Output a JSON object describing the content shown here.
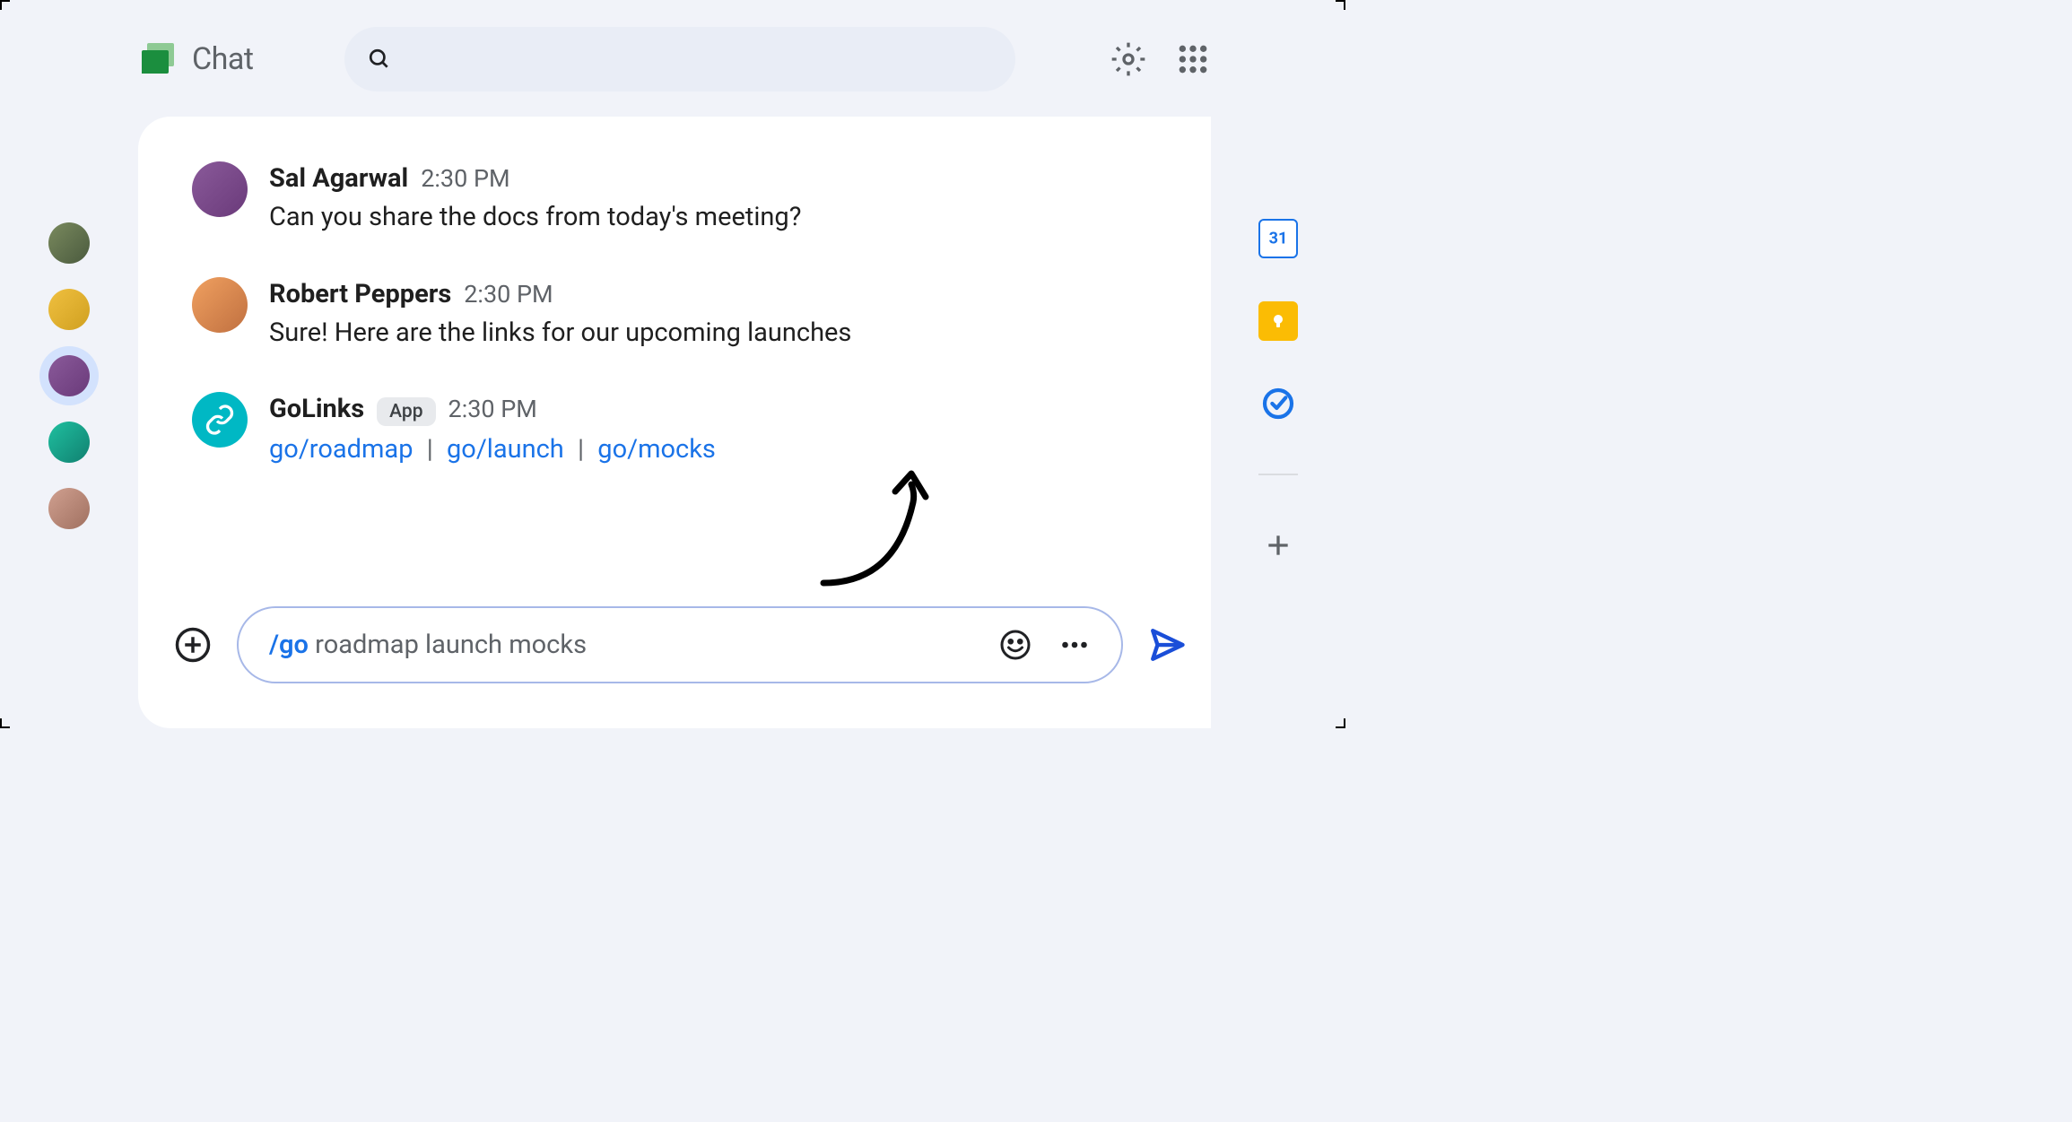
{
  "header": {
    "app_name": "Chat"
  },
  "left_rail": {
    "avatars": [
      {
        "id": "av1"
      },
      {
        "id": "av2"
      },
      {
        "id": "av3",
        "active": true
      },
      {
        "id": "av4"
      },
      {
        "id": "av5"
      }
    ]
  },
  "messages": [
    {
      "author": "Sal Agarwal",
      "time": "2:30 PM",
      "text": "Can you share the docs from today's meeting?"
    },
    {
      "author": "Robert Peppers",
      "time": "2:30 PM",
      "text": "Sure! Here are the links for our upcoming launches"
    },
    {
      "author": "GoLinks",
      "badge": "App",
      "time": "2:30 PM",
      "links": [
        "go/roadmap",
        "go/launch",
        "go/mocks"
      ]
    }
  ],
  "composer": {
    "command": "/go",
    "args": "  roadmap  launch  mocks"
  },
  "right_rail": {
    "calendar_day": "31"
  }
}
